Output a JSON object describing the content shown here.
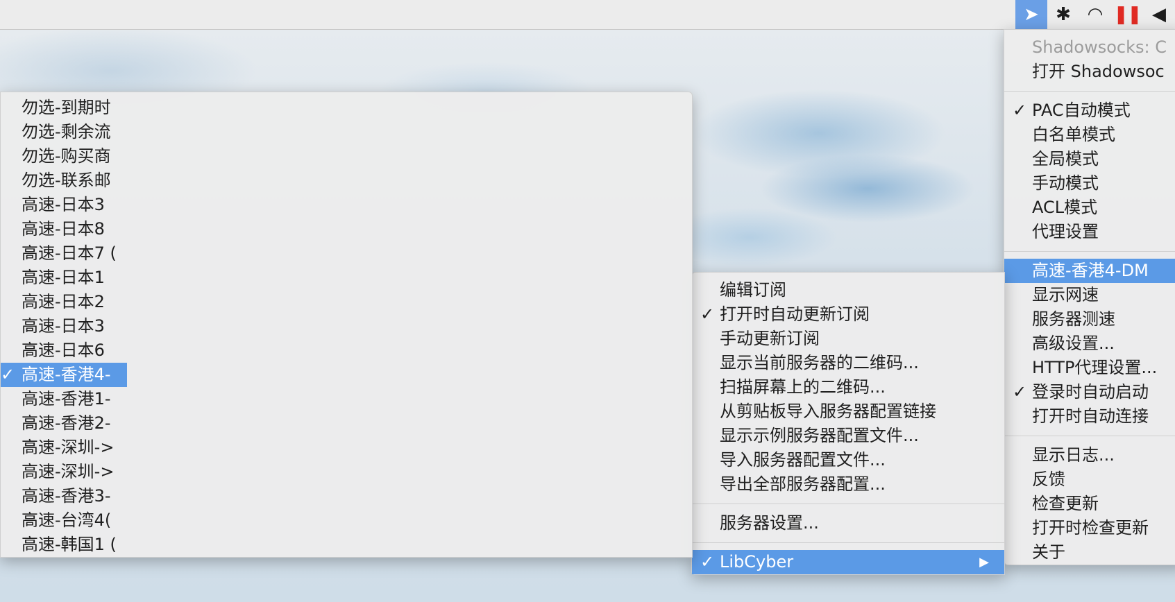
{
  "menubar": {
    "icons": [
      {
        "name": "shadowsocks-paper-plane-icon",
        "glyph": "➤"
      },
      {
        "name": "bluetooth-icon",
        "glyph": "✱"
      },
      {
        "name": "wifi-icon",
        "glyph": "◠"
      },
      {
        "name": "pause-icon",
        "glyph": "❚❚"
      },
      {
        "name": "volume-icon",
        "glyph": "◀"
      }
    ]
  },
  "main_menu": {
    "status": "Shadowsocks: C",
    "open_app": "打开 Shadowsoc",
    "modes": [
      {
        "label": "PAC自动模式",
        "checked": true
      },
      {
        "label": "白名单模式",
        "checked": false
      },
      {
        "label": "全局模式",
        "checked": false
      },
      {
        "label": "手动模式",
        "checked": false
      },
      {
        "label": "ACL模式",
        "checked": false
      },
      {
        "label": "代理设置",
        "checked": false
      }
    ],
    "server_item": "高速-香港4-DM",
    "options": [
      {
        "label": "显示网速",
        "checked": false
      },
      {
        "label": "服务器测速",
        "checked": false
      },
      {
        "label": "高级设置...",
        "checked": false
      },
      {
        "label": "HTTP代理设置...",
        "checked": false
      },
      {
        "label": "登录时自动启动",
        "checked": true
      },
      {
        "label": "打开时自动连接",
        "checked": false
      }
    ],
    "misc": [
      {
        "label": "显示日志..."
      },
      {
        "label": "反馈"
      },
      {
        "label": "检查更新"
      },
      {
        "label": "打开时检查更新"
      },
      {
        "label": "关于"
      }
    ]
  },
  "sub_menu": {
    "items": [
      {
        "label": "编辑订阅",
        "checked": false
      },
      {
        "label": "打开时自动更新订阅",
        "checked": true
      },
      {
        "label": "手动更新订阅",
        "checked": false
      },
      {
        "label": "显示当前服务器的二维码...",
        "checked": false
      },
      {
        "label": "扫描屏幕上的二维码...",
        "checked": false
      },
      {
        "label": "从剪贴板导入服务器配置链接",
        "checked": false
      },
      {
        "label": "显示示例服务器配置文件...",
        "checked": false
      },
      {
        "label": "导入服务器配置文件...",
        "checked": false
      },
      {
        "label": "导出全部服务器配置...",
        "checked": false
      }
    ],
    "server_settings": "服务器设置...",
    "group": "LibCyber",
    "group_arrow": "▶"
  },
  "server_menu": {
    "items": [
      {
        "label": "勿选-到期时",
        "checked": false
      },
      {
        "label": "勿选-剩余流",
        "checked": false
      },
      {
        "label": "勿选-购买商",
        "checked": false
      },
      {
        "label": "勿选-联系邮",
        "checked": false
      },
      {
        "label": "高速-日本3",
        "checked": false
      },
      {
        "label": "高速-日本8",
        "checked": false
      },
      {
        "label": "高速-日本7 (",
        "checked": false
      },
      {
        "label": "高速-日本1",
        "checked": false
      },
      {
        "label": "高速-日本2",
        "checked": false
      },
      {
        "label": "高速-日本3",
        "checked": false
      },
      {
        "label": "高速-日本6",
        "checked": false
      },
      {
        "label": "高速-香港4-",
        "checked": true
      },
      {
        "label": "高速-香港1-",
        "checked": false
      },
      {
        "label": "高速-香港2-",
        "checked": false
      },
      {
        "label": "高速-深圳->",
        "checked": false
      },
      {
        "label": "高速-深圳->",
        "checked": false
      },
      {
        "label": "高速-香港3-",
        "checked": false
      },
      {
        "label": "高速-台湾4(",
        "checked": false
      },
      {
        "label": "高速-韩国1 (",
        "checked": false
      }
    ]
  },
  "check_glyph": "✓"
}
